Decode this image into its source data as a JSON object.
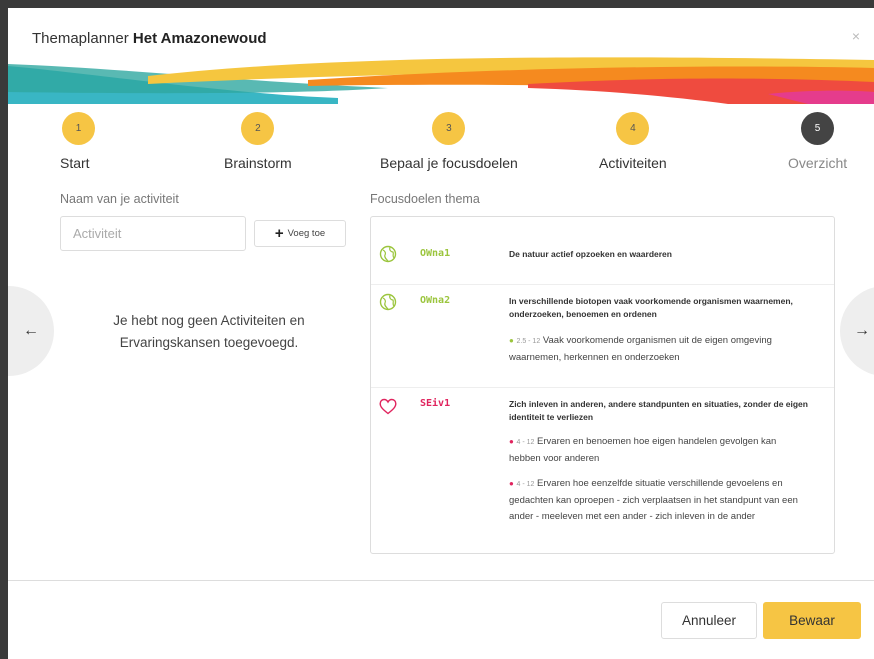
{
  "window": {
    "title_prefix": "Themaplanner",
    "title_name": "Het Amazonewoud",
    "close_label": "×"
  },
  "stepper": [
    {
      "number": "1",
      "label": "Start"
    },
    {
      "number": "2",
      "label": "Brainstorm"
    },
    {
      "number": "3",
      "label": "Bepaal je focusdoelen"
    },
    {
      "number": "4",
      "label": "Activiteiten"
    },
    {
      "number": "5",
      "label": "Overzicht"
    }
  ],
  "activity": {
    "label": "Naam van je activiteit",
    "placeholder": "Activiteit",
    "value": "",
    "add_label": "Voeg toe",
    "empty_message": "Je hebt nog geen Activiteiten en Ervaringskansen toegevoegd."
  },
  "nav": {
    "prev": "←",
    "next": "→"
  },
  "focus": {
    "label": "Focusdoelen thema",
    "goals": [
      {
        "code": "OWna1",
        "title": "De natuur actief opzoeken en waarderen",
        "subs": []
      },
      {
        "code": "OWna2",
        "title": "In verschillende biotopen vaak voorkomende organismen waarnemen, onderzoeken, benoemen en ordenen",
        "subs": [
          {
            "age": "2.5 - 12",
            "text": "Vaak voorkomende organismen uit de eigen omgeving waarnemen, herkennen en onderzoeken"
          }
        ]
      },
      {
        "code": "SEiv1",
        "title": "Zich inleven in anderen, andere standpunten en situaties, zonder de eigen identiteit te verliezen",
        "subs": [
          {
            "age": "4 - 12",
            "text": "Ervaren en benoemen hoe eigen handelen gevolgen kan hebben voor anderen"
          },
          {
            "age": "4 - 12",
            "text": "Ervaren hoe eenzelfde situatie verschillende gevoelens en gedachten kan oproepen - zich verplaatsen in het standpunt van een ander - meeleven met een ander - zich inleven in de ander"
          }
        ]
      }
    ]
  },
  "footer": {
    "cancel_label": "Annuleer",
    "save_label": "Bewaar"
  },
  "colors": {
    "accent_yellow": "#f6c544",
    "step_dark": "#444444",
    "green": "#9bc53d",
    "red": "#e0245e",
    "banner_teal": "#3ab3c1",
    "banner_orange": "#f47b20"
  },
  "icons": {
    "globe": "globe-icon",
    "heart": "heart-icon",
    "plus": "plus-icon"
  }
}
